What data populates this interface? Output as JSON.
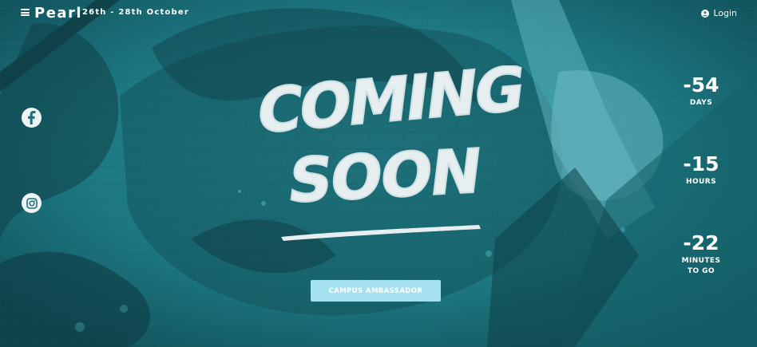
{
  "header": {
    "brand": "Pearl",
    "dates": "26th - 28th October",
    "login_label": "Login"
  },
  "hero": {
    "title_line1": "COMING",
    "title_line2": "SOON",
    "cta_label": "CAMPUS AMBASSADOR"
  },
  "social": {
    "facebook_icon": "facebook-icon",
    "instagram_icon": "instagram-icon"
  },
  "countdown": {
    "days_value": "-54",
    "days_label": "DAYS",
    "hours_value": "-15",
    "hours_label": "HOURS",
    "minutes_value": "-22",
    "minutes_label": "MINUTES\nTO GO"
  },
  "colors": {
    "background": "#1f7f8a",
    "cta_button": "#a6e1f2",
    "text": "#ffffff"
  }
}
